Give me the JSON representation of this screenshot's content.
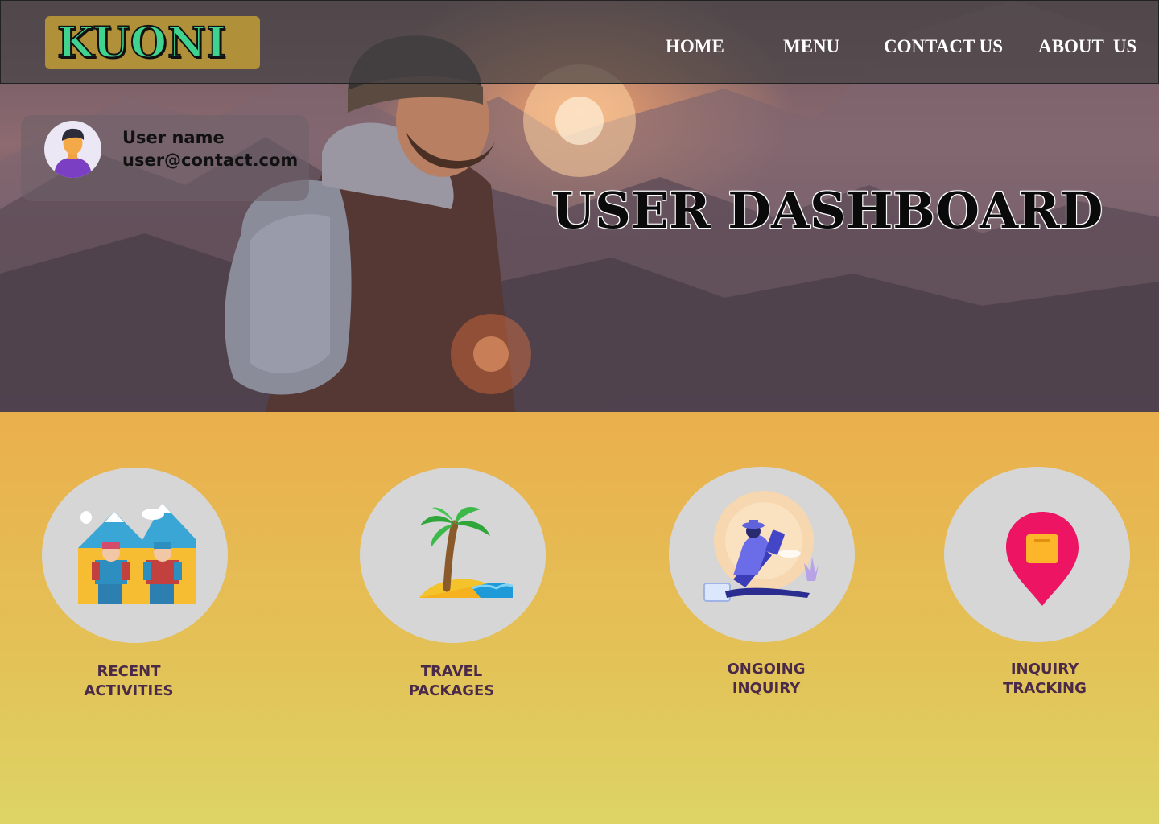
{
  "brand": {
    "logo_text": "KUONI",
    "logo_color": "#3fd38f",
    "logo_bg": "#b0913a"
  },
  "nav": {
    "items": [
      {
        "label": "HOME"
      },
      {
        "label": "MENU"
      },
      {
        "label": "CONTACT US"
      },
      {
        "label": "ABOUT  US"
      }
    ]
  },
  "user": {
    "name": "User name",
    "email": "user@contact.com",
    "avatar_icon": "user-avatar-icon"
  },
  "hero": {
    "title": "USER DASHBOARD"
  },
  "tiles": [
    {
      "line1": "RECENT",
      "line2": "ACTIVITIES",
      "icon": "hikers-icon"
    },
    {
      "line1": "TRAVEL",
      "line2": "PACKAGES",
      "icon": "palm-beach-icon"
    },
    {
      "line1": "ONGOING",
      "line2": "INQUIRY",
      "icon": "reading-traveler-icon"
    },
    {
      "line1": "INQUIRY",
      "line2": "TRACKING",
      "icon": "location-pin-icon"
    }
  ],
  "colors": {
    "tile_bg": "#d6d6d6",
    "label_color": "#4a2a48",
    "gradient_top": "#f0a347",
    "gradient_bottom": "#ddd466"
  }
}
